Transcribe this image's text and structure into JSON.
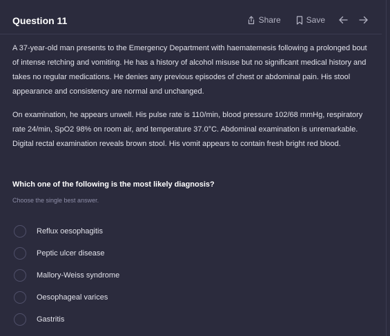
{
  "question": {
    "title": "Question 11",
    "share_label": "Share",
    "save_label": "Save",
    "paragraph1": "A 37-year-old man presents to the Emergency Department with haematemesis following a prolonged bout of intense retching and vomiting. He has a history of alcohol misuse but no significant medical history and takes no regular medications. He denies any previous episodes of chest or abdominal pain. His stool appearance and consistency are normal and unchanged.",
    "paragraph2": "On examination, he appears unwell. His pulse rate is 110/min, blood pressure 102/68 mmHg, respiratory rate 24/min, SpO2 98% on room air, and temperature 37.0°C. Abdominal examination is unremarkable. Digital rectal examination reveals brown stool. His vomit appears to contain fresh bright red blood.",
    "prompt": "Which one of the following is the most likely diagnosis?",
    "hint": "Choose the single best answer.",
    "options": [
      {
        "label": "Reflux oesophagitis"
      },
      {
        "label": "Peptic ulcer disease"
      },
      {
        "label": "Mallory-Weiss syndrome"
      },
      {
        "label": "Oesophageal varices"
      },
      {
        "label": "Gastritis"
      }
    ]
  }
}
